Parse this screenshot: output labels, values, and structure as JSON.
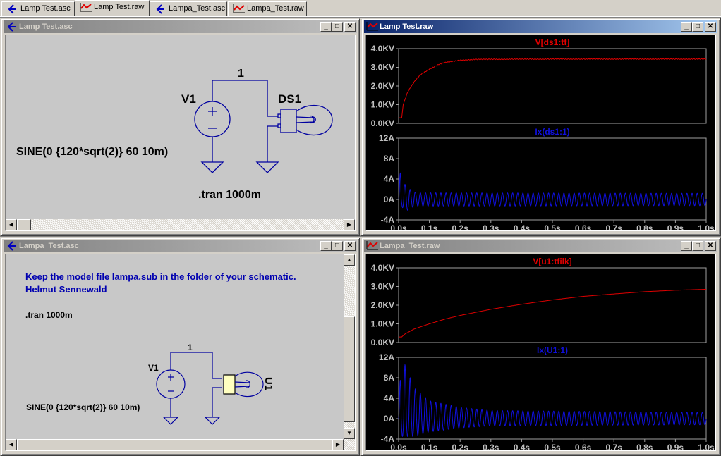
{
  "tabs": [
    {
      "label": "Lamp Test.asc",
      "icon": "schematic-icon"
    },
    {
      "label": "Lamp Test.raw",
      "icon": "waveform-icon"
    },
    {
      "label": "Lampa_Test.asc",
      "icon": "schematic-icon"
    },
    {
      "label": "Lampa_Test.raw",
      "icon": "waveform-icon"
    }
  ],
  "window_buttons": {
    "minimize": "_",
    "maximize": "□",
    "close": "✕"
  },
  "sch1": {
    "title": "Lamp Test.asc",
    "net": "1",
    "v1": "V1",
    "ds1": "DS1",
    "source": "SINE(0 {120*sqrt(2)} 60 10m)",
    "tran": ".tran 1000m"
  },
  "sch2": {
    "title": "Lampa_Test.asc",
    "note1": "Keep the model file lampa.sub in the folder of your schematic.",
    "note2": "Helmut Sennewald",
    "tran": ".tran 1000m",
    "net": "1",
    "v1": "V1",
    "u1": "U1",
    "source": "SINE(0 {120*sqrt(2)} 60 10m)"
  },
  "raw1": {
    "title": "Lamp Test.raw"
  },
  "raw2": {
    "title": "Lampa_Test.raw"
  },
  "colors": {
    "voltage": "#e00000",
    "current": "#1010e0",
    "grid": "#a0a0a0",
    "axis_text": "#c0c0c0"
  },
  "chart_data": [
    {
      "type": "line",
      "window": "Lamp Test.raw",
      "title": "V[ds1:tf]",
      "unit": "KV",
      "yticks": [
        "4.0KV",
        "3.0KV",
        "2.0KV",
        "1.0KV",
        "0.0KV"
      ],
      "ylim": [
        0,
        4
      ],
      "x": [
        0,
        0.01,
        0.015,
        0.02,
        0.03,
        0.05,
        0.07,
        0.1,
        0.13,
        0.15,
        0.2,
        0.25,
        0.3,
        0.5,
        1.0
      ],
      "values": [
        0.3,
        0.3,
        1.0,
        1.25,
        1.7,
        2.2,
        2.6,
        2.9,
        3.15,
        3.25,
        3.38,
        3.42,
        3.43,
        3.44,
        3.44
      ],
      "ripple": 0.02
    },
    {
      "type": "line",
      "window": "Lamp Test.raw",
      "title": "Ix(ds1:1)",
      "unit": "A",
      "yticks": [
        "12A",
        "8A",
        "4A",
        "0A",
        "-4A"
      ],
      "ylim": [
        -4,
        12
      ],
      "frequency_hz": 60,
      "envelope_x": [
        0,
        0.008,
        0.02,
        0.04,
        0.06,
        1.0
      ],
      "envelope_peak": [
        0,
        8.5,
        3.0,
        1.8,
        1.3,
        1.2
      ],
      "envelope_trough": [
        0,
        -1,
        -2.5,
        -1.6,
        -1.3,
        -1.2
      ]
    },
    {
      "type": "line",
      "window": "Lampa_Test.raw",
      "title": "V[u1:tfilk]",
      "unit": "KV",
      "yticks": [
        "4.0KV",
        "3.0KV",
        "2.0KV",
        "1.0KV",
        "0.0KV"
      ],
      "ylim": [
        0,
        4
      ],
      "x": [
        0,
        0.01,
        0.02,
        0.05,
        0.1,
        0.15,
        0.2,
        0.3,
        0.4,
        0.5,
        0.6,
        0.7,
        0.8,
        0.9,
        1.0
      ],
      "values": [
        0.3,
        0.3,
        0.45,
        0.72,
        1.0,
        1.25,
        1.45,
        1.78,
        2.05,
        2.28,
        2.47,
        2.6,
        2.72,
        2.8,
        2.85
      ],
      "ripple": 0
    },
    {
      "type": "line",
      "window": "Lampa_Test.raw",
      "title": "Ix(U1:1)",
      "unit": "A",
      "yticks": [
        "12A",
        "8A",
        "4A",
        "0A",
        "-4A"
      ],
      "ylim": [
        -4,
        12
      ],
      "frequency_hz": 60,
      "envelope_x": [
        0,
        0.008,
        0.05,
        0.1,
        0.2,
        0.3,
        1.0
      ],
      "envelope_peak": [
        0,
        12.5,
        6,
        3.5,
        2.2,
        1.6,
        1.2
      ],
      "envelope_trough": [
        0,
        -3.5,
        -3.5,
        -2.6,
        -1.8,
        -1.4,
        -1.2
      ]
    }
  ],
  "xticks": [
    "0.0s",
    "0.1s",
    "0.2s",
    "0.3s",
    "0.4s",
    "0.5s",
    "0.6s",
    "0.7s",
    "0.8s",
    "0.9s",
    "1.0s"
  ],
  "xlim": [
    0,
    1
  ]
}
